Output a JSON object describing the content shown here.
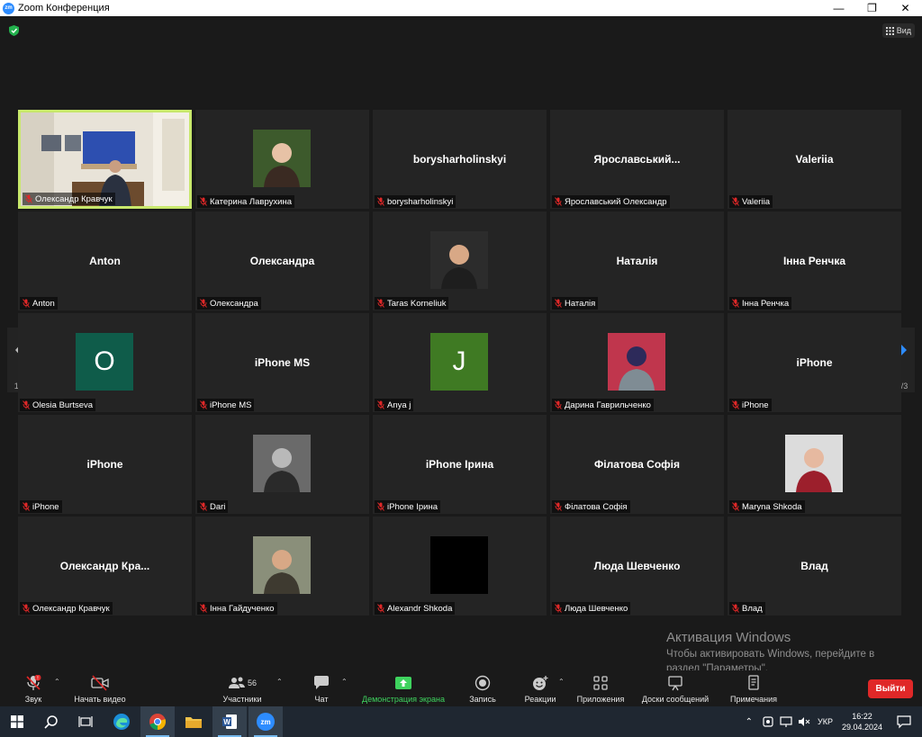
{
  "window": {
    "title": "Zoom Конференция",
    "logo": "zm"
  },
  "topbar": {
    "view_label": "Вид"
  },
  "tiles": [
    {
      "name": "Олександр Кравчук",
      "center": "",
      "kind": "video"
    },
    {
      "name": "Катерина Лаврухина",
      "center": "",
      "kind": "photo"
    },
    {
      "name": "borysharholinskyi",
      "center": "borysharholinskyi",
      "kind": "text"
    },
    {
      "name": "Ярославський Олександр",
      "center": "Ярославський...",
      "kind": "text"
    },
    {
      "name": "Valeriia",
      "center": "Valeriia",
      "kind": "text"
    },
    {
      "name": "Anton",
      "center": "Anton",
      "kind": "text"
    },
    {
      "name": "Олександра",
      "center": "Олександра",
      "kind": "text"
    },
    {
      "name": "Taras Korneliuk",
      "center": "",
      "kind": "photo"
    },
    {
      "name": "Наталія",
      "center": "Наталія",
      "kind": "text"
    },
    {
      "name": "Інна Ренчка",
      "center": "Інна Ренчка",
      "kind": "text"
    },
    {
      "name": "Olesia Burtseva",
      "center": "O",
      "kind": "letter",
      "color": "#0f5c4a"
    },
    {
      "name": "iPhone MS",
      "center": "iPhone MS",
      "kind": "text"
    },
    {
      "name": "Anya j",
      "center": "J",
      "kind": "letter",
      "color": "#3f7a23"
    },
    {
      "name": "Дарина Гаврильченко",
      "center": "",
      "kind": "photo"
    },
    {
      "name": "iPhone",
      "center": "iPhone",
      "kind": "text"
    },
    {
      "name": "iPhone",
      "center": "iPhone",
      "kind": "text"
    },
    {
      "name": "Dari",
      "center": "",
      "kind": "photo"
    },
    {
      "name": "iPhone Ірина",
      "center": "iPhone Ірина",
      "kind": "text"
    },
    {
      "name": "Філатова Софія",
      "center": "Філатова Софія",
      "kind": "text"
    },
    {
      "name": "Maryna Shkoda",
      "center": "",
      "kind": "photo"
    },
    {
      "name": "Олександр Кравчук",
      "center": "Олександр Кра...",
      "kind": "text"
    },
    {
      "name": "Інна Гайдученко",
      "center": "",
      "kind": "photo"
    },
    {
      "name": "Alexandr Shkoda",
      "center": "",
      "kind": "black"
    },
    {
      "name": "Люда Шевченко",
      "center": "Люда Шевченко",
      "kind": "text"
    },
    {
      "name": "Влад",
      "center": "Влад",
      "kind": "text"
    }
  ],
  "pagination": {
    "left": "1/3",
    "right": "1/3"
  },
  "activation": {
    "title": "Активация Windows",
    "line1": "Чтобы активировать Windows, перейдите в",
    "line2": "раздел \"Параметры\"."
  },
  "toolbar": {
    "audio": "Звук",
    "video": "Начать видео",
    "participants": "Участники",
    "participants_count": "56",
    "chat": "Чат",
    "share": "Демонстрация экрана",
    "record": "Запись",
    "reactions": "Реакции",
    "apps": "Приложения",
    "whiteboards": "Доски сообщений",
    "notes": "Примечания",
    "exit": "Выйти",
    "audio_badge": "!"
  },
  "taskbar": {
    "lang": "УКР",
    "time": "16:22",
    "date": "29.04.2024",
    "zoom_label": "zm"
  },
  "colors": {
    "share_green": "#3ed35e",
    "exit_red": "#e02828",
    "active_border": "#c8e86c",
    "mute_red": "#e02828"
  }
}
